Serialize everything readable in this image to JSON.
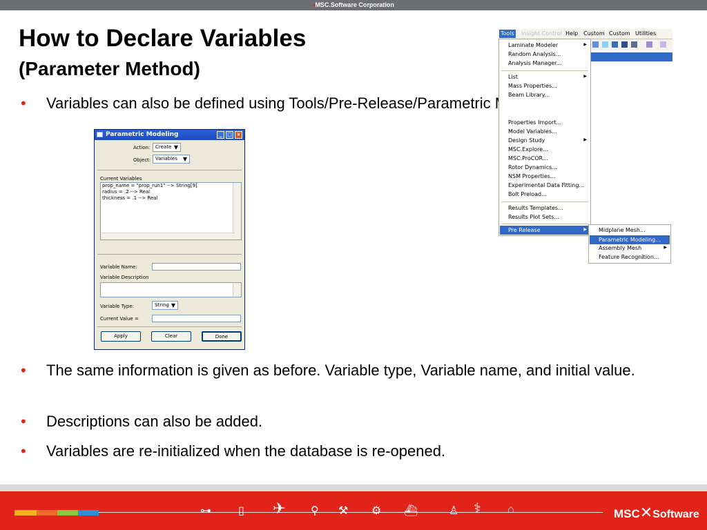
{
  "header": {
    "company": "MSC.Software Corporation"
  },
  "slide": {
    "title": "How to Declare Variables",
    "subtitle": "(Parameter Method)",
    "bullets": [
      "Variables can also be defined using Tools/Pre-Release/Parametric Modeling.",
      "The same information is given as before.  Variable type, Variable name, and initial value.",
      "Descriptions can also be added.",
      "Variables are re-initialized when the database is re-opened."
    ],
    "bullet_mark": "•"
  },
  "dialog": {
    "title": "Parametric Modeling",
    "action_label": "Action:",
    "action_value": "Create",
    "object_label": "Object:",
    "object_value": "Variables",
    "current_variables_label": "Current Variables",
    "variables": [
      "prop_name = \"prop_run1\" --> String[9]",
      "radius = .2 --> Real",
      "thickness = .1 --> Real"
    ],
    "variable_name_label": "Variable Name:",
    "variable_description_label": "Variable Description",
    "variable_type_label": "Variable Type:",
    "variable_type_value": "String",
    "current_value_label": "Current Value =",
    "apply_label": "Apply",
    "clear_label": "Clear",
    "done_label": "Done"
  },
  "menubar": {
    "items": [
      "Tools",
      "Insight Control",
      "Help",
      "Custom",
      "Custom",
      "Utilities"
    ]
  },
  "tools_menu": {
    "items": [
      "Laminate Modeler",
      "Random Analysis...",
      "Analysis Manager...",
      "List",
      "Mass Properties...",
      "Beam Library...",
      "Properties Import...",
      "Model Variables...",
      "Design Study",
      "MSC.Explore...",
      "MSC.ProCOR...",
      "Rotor Dynamics...",
      "NSM Properties...",
      "Experimental Data Fitting...",
      "Bolt Preload...",
      "Results Templates...",
      "Results Plot Sets...",
      "Pre Release"
    ]
  },
  "pre_release_submenu": {
    "items": [
      "Midplane Mesh...",
      "Parametric Modeling...",
      "Assembly Mesh",
      "Feature Recognition..."
    ]
  },
  "footer": {
    "logo_left": "MSC",
    "logo_right": "Software"
  },
  "colors": {
    "accent": "#e2231a",
    "menu_highlight": "#316ac5",
    "titlebar": "#2d62d8"
  }
}
